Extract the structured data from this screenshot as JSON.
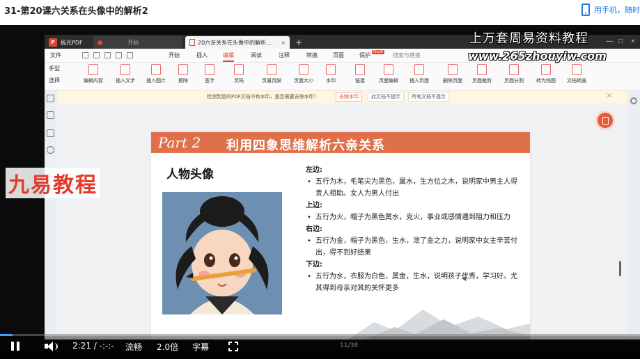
{
  "page": {
    "title": "31-第20课六关系在头像中的解析2",
    "mobile_link": "用手机，随时"
  },
  "app": {
    "brand": "极光PDF",
    "tabs": [
      {
        "label": "开始"
      },
      {
        "label": "20六亲关系在头像中的解析..."
      }
    ],
    "menu": {
      "file": "文件",
      "items": [
        "开始",
        "插入",
        "编辑",
        "阅读",
        "注释",
        "转换",
        "页面",
        "保护"
      ],
      "active": "编辑",
      "new_badge": "NEW",
      "search": "搜索与替换"
    },
    "side_tools": {
      "hand": "手型",
      "select": "选择"
    },
    "ribbon": [
      "编辑内容",
      "插入文字",
      "插入图片",
      "擦除",
      "签字",
      "页码",
      "页眉页脚",
      "页面大小",
      "水印",
      "链接",
      "页面编辑",
      "插入页面",
      "删除页面",
      "页面裁剪",
      "页面分割",
      "转为纯图",
      "文档转曲"
    ],
    "notice": {
      "message": "检测到您的PDF文档中有水印，是否需要去除水印?",
      "btn_remove": "去除水印",
      "btn_skip": "此文档不提示",
      "btn_all": "所有文档不提示"
    },
    "pager": "11/38"
  },
  "slide": {
    "part": "Part 2",
    "title": "利用四象思维解析六亲关系",
    "head_label": "人物头像",
    "sections": [
      {
        "head": "左边:",
        "text": "五行为木，毛笔尖为黑色，属水，生方位之木，说明家中男主人得贵人相助。女人为男人付出"
      },
      {
        "head": "上边:",
        "text": "五行为火，帽子为黑色属水，克火，事业或感情遇到阻力和压力"
      },
      {
        "head": "右边:",
        "text": "五行为金，帽子为黑色，生水，泄了金之力，说明家中女主辛苦付出，得不到好结果"
      },
      {
        "head": "下边:",
        "text": "五行为水，衣服为白色，属金，生水，说明孩子优秀，学习好。尤其得到母亲对其的关怀更多"
      }
    ]
  },
  "watermarks": {
    "top": "上万套周易资料教程",
    "url": "www.265zhouyiw.com",
    "brand": "九易教程"
  },
  "player": {
    "time": "2:21 / -:-:-",
    "rate_label": "流畅",
    "speed": "2.0倍",
    "subtitle": "字幕",
    "progress": 0.02
  },
  "colors": {
    "accent": "#e44332",
    "banner": "#e0704a",
    "link": "#1f7ae0",
    "progress": "#3aa0ff"
  }
}
